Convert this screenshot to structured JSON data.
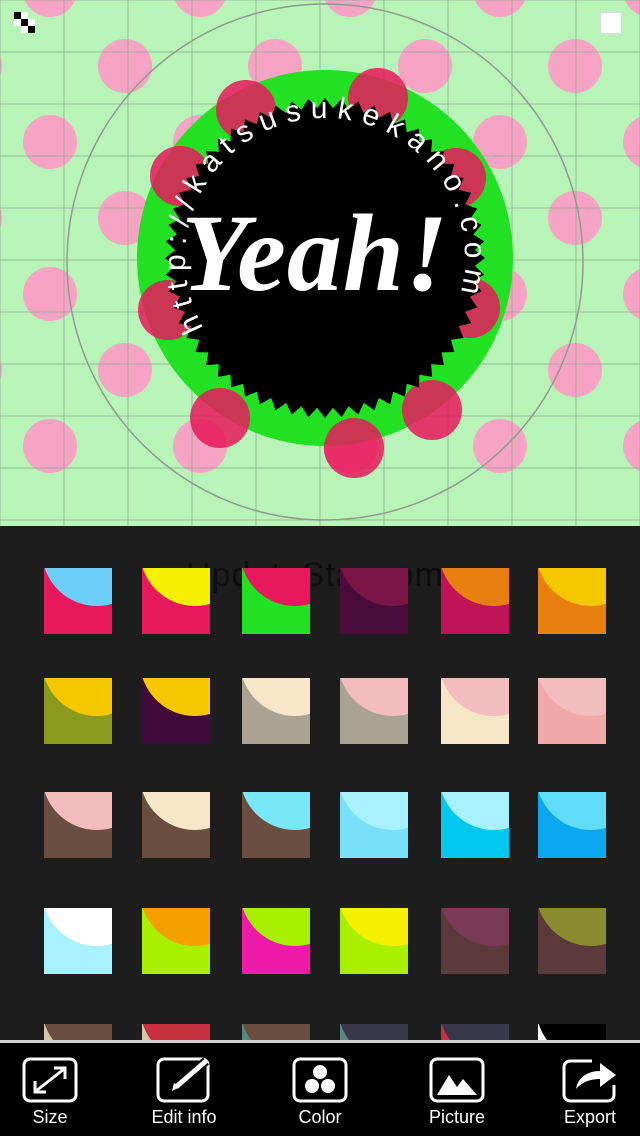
{
  "canvas": {
    "background": "#b8f3b8",
    "dot_color": "#f7a3c4",
    "badge": {
      "ring_color": "#22e022",
      "circle_color": "#000000",
      "title": "Yeah!",
      "circle_text": "http://katsusukekano.com"
    }
  },
  "palette": {
    "watermark": "UpdateStar.com",
    "swatches": [
      {
        "base": "#e8185c",
        "accent": "#6ccff8"
      },
      {
        "base": "#e8185c",
        "accent": "#f5f000"
      },
      {
        "base": "#22e022",
        "accent": "#e8185c"
      },
      {
        "base": "#4a0c3a",
        "accent": "#7a1545"
      },
      {
        "base": "#c01456",
        "accent": "#e88010"
      },
      {
        "base": "#e88010",
        "accent": "#f5c800"
      },
      {
        "base": "#8a9a1c",
        "accent": "#f5c800"
      },
      {
        "base": "#3e0b3a",
        "accent": "#f5c800"
      },
      {
        "base": "#aaa292",
        "accent": "#f7e6c8"
      },
      {
        "base": "#aaa292",
        "accent": "#f3bdbd"
      },
      {
        "base": "#f7e6c8",
        "accent": "#f3bdbd"
      },
      {
        "base": "#f0a8a8",
        "accent": "#f3bdbd"
      },
      {
        "base": "#6a4e40",
        "accent": "#f3bdbd"
      },
      {
        "base": "#6a4e40",
        "accent": "#f7e6c8"
      },
      {
        "base": "#6a4e40",
        "accent": "#78e8f8"
      },
      {
        "base": "#78e0f8",
        "accent": "#a8f2ff"
      },
      {
        "base": "#00c8f0",
        "accent": "#a8f2ff"
      },
      {
        "base": "#0aa8f0",
        "accent": "#60dcf8"
      },
      {
        "base": "#a8f2ff",
        "accent": "#ffffff"
      },
      {
        "base": "#a8f000",
        "accent": "#f5a000"
      },
      {
        "base": "#f01aa8",
        "accent": "#a8f000"
      },
      {
        "base": "#a8f000",
        "accent": "#f5f000"
      },
      {
        "base": "#5a3a3a",
        "accent": "#7a3a56"
      },
      {
        "base": "#5a3a3a",
        "accent": "#8a8a30"
      },
      {
        "base": "#d6c6a8",
        "accent": "#6a4e40"
      },
      {
        "base": "#d6c6a8",
        "accent": "#c83040"
      },
      {
        "base": "#5a8880",
        "accent": "#6a4e40"
      },
      {
        "base": "#5a8880",
        "accent": "#38384a"
      },
      {
        "base": "#c83040",
        "accent": "#38384a"
      },
      {
        "base": "#ffffff",
        "accent": "#000000"
      }
    ]
  },
  "toolbar": {
    "items": [
      {
        "label": "Size",
        "icon": "resize-icon"
      },
      {
        "label": "Edit info",
        "icon": "edit-icon"
      },
      {
        "label": "Color",
        "icon": "color-icon"
      },
      {
        "label": "Picture",
        "icon": "picture-icon"
      },
      {
        "label": "Export",
        "icon": "export-icon"
      }
    ]
  }
}
